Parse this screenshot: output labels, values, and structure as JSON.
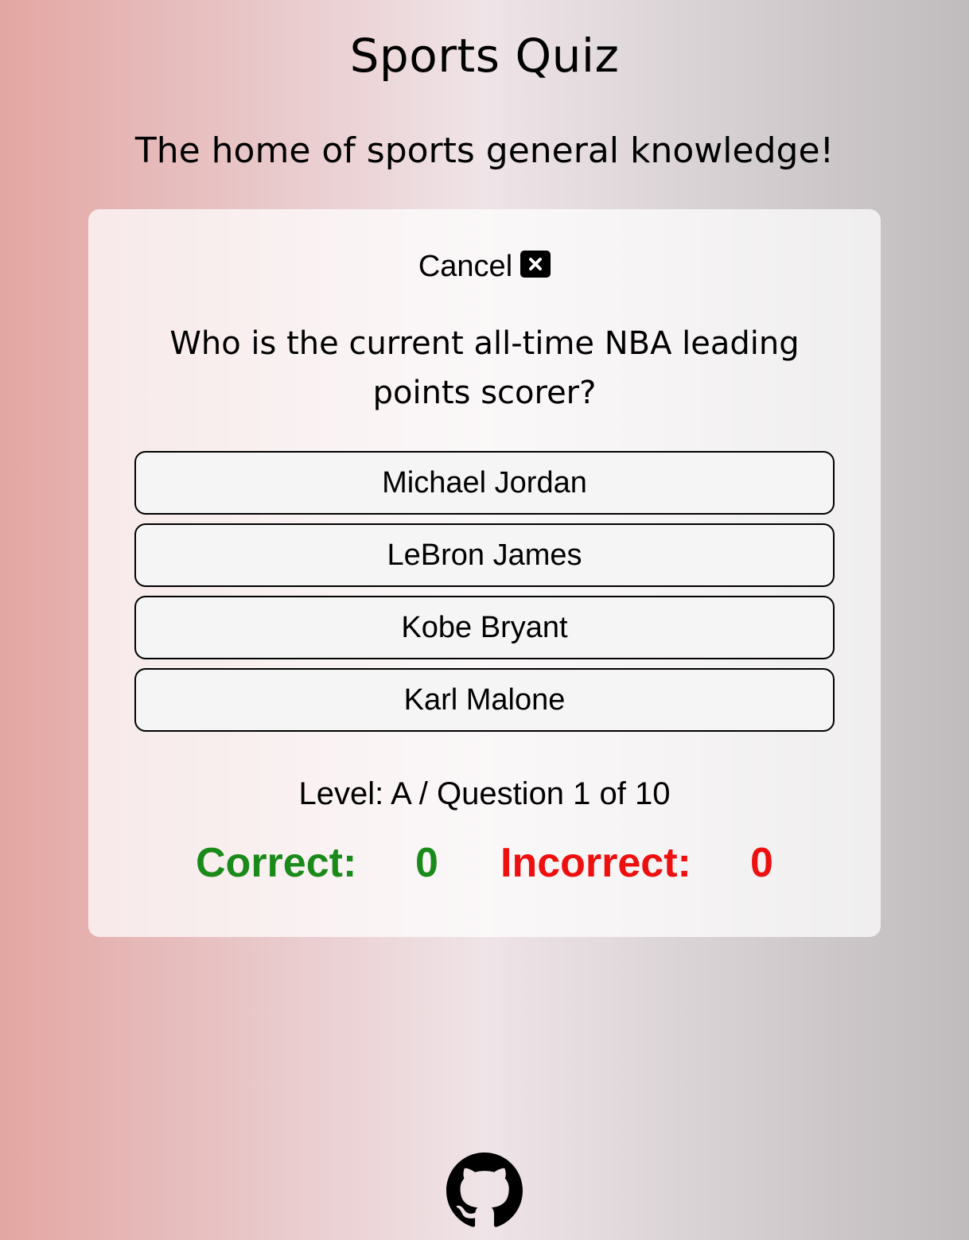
{
  "header": {
    "title": "Sports Quiz",
    "subtitle": "The home of sports general knowledge!"
  },
  "quiz": {
    "cancel_label": "Cancel",
    "cancel_icon": "close-icon",
    "question": "Who is the current all-time NBA leading points scorer?",
    "answers": [
      {
        "label": "Michael Jordan"
      },
      {
        "label": "LeBron James"
      },
      {
        "label": "Kobe Bryant"
      },
      {
        "label": "Karl Malone"
      }
    ],
    "progress": "Level: A / Question 1 of 10",
    "score": {
      "correct_label": "Correct:",
      "correct_value": "0",
      "incorrect_label": "Incorrect:",
      "incorrect_value": "0"
    }
  },
  "footer": {
    "icon": "github-icon"
  },
  "colors": {
    "correct": "#1a8a1a",
    "incorrect": "#ee0f0f",
    "button_bg": "#f5f5f5"
  }
}
